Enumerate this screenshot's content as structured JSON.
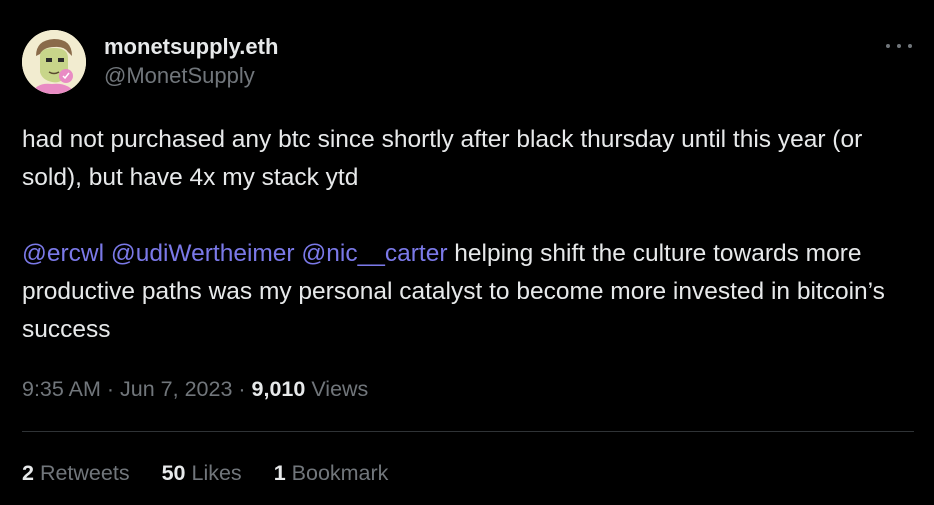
{
  "author": {
    "display_name": "monetsupply.eth",
    "handle": "@MonetSupply"
  },
  "tweet": {
    "paragraph_1": "had not purchased any btc since shortly after black thursday until this year (or sold), but have 4x my stack ytd",
    "mentions": [
      "@ercwl",
      "@udiWertheimer",
      "@nic__carter"
    ],
    "paragraph_2_text": "helping shift the culture towards more productive paths was my personal catalyst to become more invested in bitcoin’s success"
  },
  "meta": {
    "time": "9:35 AM",
    "date": "Jun 7, 2023",
    "separator": "·",
    "views_count": "9,010",
    "views_label": "Views"
  },
  "stats": {
    "retweets_count": "2",
    "retweets_label": "Retweets",
    "likes_count": "50",
    "likes_label": "Likes",
    "bookmarks_count": "1",
    "bookmarks_label": "Bookmark"
  },
  "colors": {
    "background": "#000000",
    "text": "#e7e9ea",
    "secondary_text": "#71767b",
    "mention": "#7b79e8",
    "divider": "#2f3336"
  },
  "icons": [
    "avatar-illustration",
    "more-options-icon"
  ]
}
